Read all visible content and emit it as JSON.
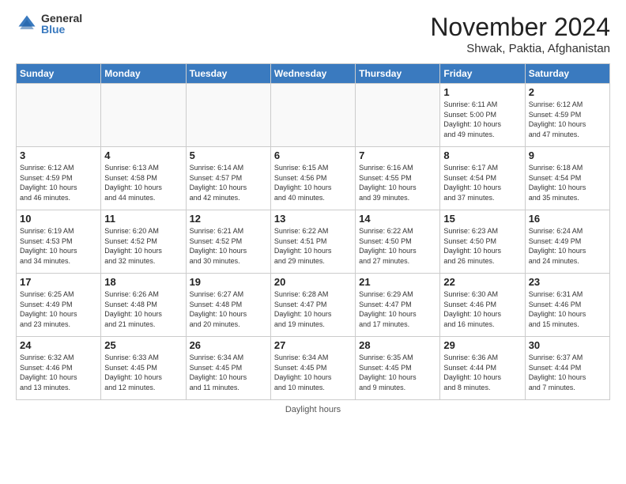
{
  "logo": {
    "general": "General",
    "blue": "Blue"
  },
  "title": "November 2024",
  "location": "Shwak, Paktia, Afghanistan",
  "days_header": [
    "Sunday",
    "Monday",
    "Tuesday",
    "Wednesday",
    "Thursday",
    "Friday",
    "Saturday"
  ],
  "footer": "Daylight hours",
  "weeks": [
    [
      {
        "day": "",
        "info": ""
      },
      {
        "day": "",
        "info": ""
      },
      {
        "day": "",
        "info": ""
      },
      {
        "day": "",
        "info": ""
      },
      {
        "day": "",
        "info": ""
      },
      {
        "day": "1",
        "info": "Sunrise: 6:11 AM\nSunset: 5:00 PM\nDaylight: 10 hours\nand 49 minutes."
      },
      {
        "day": "2",
        "info": "Sunrise: 6:12 AM\nSunset: 4:59 PM\nDaylight: 10 hours\nand 47 minutes."
      }
    ],
    [
      {
        "day": "3",
        "info": "Sunrise: 6:12 AM\nSunset: 4:59 PM\nDaylight: 10 hours\nand 46 minutes."
      },
      {
        "day": "4",
        "info": "Sunrise: 6:13 AM\nSunset: 4:58 PM\nDaylight: 10 hours\nand 44 minutes."
      },
      {
        "day": "5",
        "info": "Sunrise: 6:14 AM\nSunset: 4:57 PM\nDaylight: 10 hours\nand 42 minutes."
      },
      {
        "day": "6",
        "info": "Sunrise: 6:15 AM\nSunset: 4:56 PM\nDaylight: 10 hours\nand 40 minutes."
      },
      {
        "day": "7",
        "info": "Sunrise: 6:16 AM\nSunset: 4:55 PM\nDaylight: 10 hours\nand 39 minutes."
      },
      {
        "day": "8",
        "info": "Sunrise: 6:17 AM\nSunset: 4:54 PM\nDaylight: 10 hours\nand 37 minutes."
      },
      {
        "day": "9",
        "info": "Sunrise: 6:18 AM\nSunset: 4:54 PM\nDaylight: 10 hours\nand 35 minutes."
      }
    ],
    [
      {
        "day": "10",
        "info": "Sunrise: 6:19 AM\nSunset: 4:53 PM\nDaylight: 10 hours\nand 34 minutes."
      },
      {
        "day": "11",
        "info": "Sunrise: 6:20 AM\nSunset: 4:52 PM\nDaylight: 10 hours\nand 32 minutes."
      },
      {
        "day": "12",
        "info": "Sunrise: 6:21 AM\nSunset: 4:52 PM\nDaylight: 10 hours\nand 30 minutes."
      },
      {
        "day": "13",
        "info": "Sunrise: 6:22 AM\nSunset: 4:51 PM\nDaylight: 10 hours\nand 29 minutes."
      },
      {
        "day": "14",
        "info": "Sunrise: 6:22 AM\nSunset: 4:50 PM\nDaylight: 10 hours\nand 27 minutes."
      },
      {
        "day": "15",
        "info": "Sunrise: 6:23 AM\nSunset: 4:50 PM\nDaylight: 10 hours\nand 26 minutes."
      },
      {
        "day": "16",
        "info": "Sunrise: 6:24 AM\nSunset: 4:49 PM\nDaylight: 10 hours\nand 24 minutes."
      }
    ],
    [
      {
        "day": "17",
        "info": "Sunrise: 6:25 AM\nSunset: 4:49 PM\nDaylight: 10 hours\nand 23 minutes."
      },
      {
        "day": "18",
        "info": "Sunrise: 6:26 AM\nSunset: 4:48 PM\nDaylight: 10 hours\nand 21 minutes."
      },
      {
        "day": "19",
        "info": "Sunrise: 6:27 AM\nSunset: 4:48 PM\nDaylight: 10 hours\nand 20 minutes."
      },
      {
        "day": "20",
        "info": "Sunrise: 6:28 AM\nSunset: 4:47 PM\nDaylight: 10 hours\nand 19 minutes."
      },
      {
        "day": "21",
        "info": "Sunrise: 6:29 AM\nSunset: 4:47 PM\nDaylight: 10 hours\nand 17 minutes."
      },
      {
        "day": "22",
        "info": "Sunrise: 6:30 AM\nSunset: 4:46 PM\nDaylight: 10 hours\nand 16 minutes."
      },
      {
        "day": "23",
        "info": "Sunrise: 6:31 AM\nSunset: 4:46 PM\nDaylight: 10 hours\nand 15 minutes."
      }
    ],
    [
      {
        "day": "24",
        "info": "Sunrise: 6:32 AM\nSunset: 4:46 PM\nDaylight: 10 hours\nand 13 minutes."
      },
      {
        "day": "25",
        "info": "Sunrise: 6:33 AM\nSunset: 4:45 PM\nDaylight: 10 hours\nand 12 minutes."
      },
      {
        "day": "26",
        "info": "Sunrise: 6:34 AM\nSunset: 4:45 PM\nDaylight: 10 hours\nand 11 minutes."
      },
      {
        "day": "27",
        "info": "Sunrise: 6:34 AM\nSunset: 4:45 PM\nDaylight: 10 hours\nand 10 minutes."
      },
      {
        "day": "28",
        "info": "Sunrise: 6:35 AM\nSunset: 4:45 PM\nDaylight: 10 hours\nand 9 minutes."
      },
      {
        "day": "29",
        "info": "Sunrise: 6:36 AM\nSunset: 4:44 PM\nDaylight: 10 hours\nand 8 minutes."
      },
      {
        "day": "30",
        "info": "Sunrise: 6:37 AM\nSunset: 4:44 PM\nDaylight: 10 hours\nand 7 minutes."
      }
    ]
  ]
}
